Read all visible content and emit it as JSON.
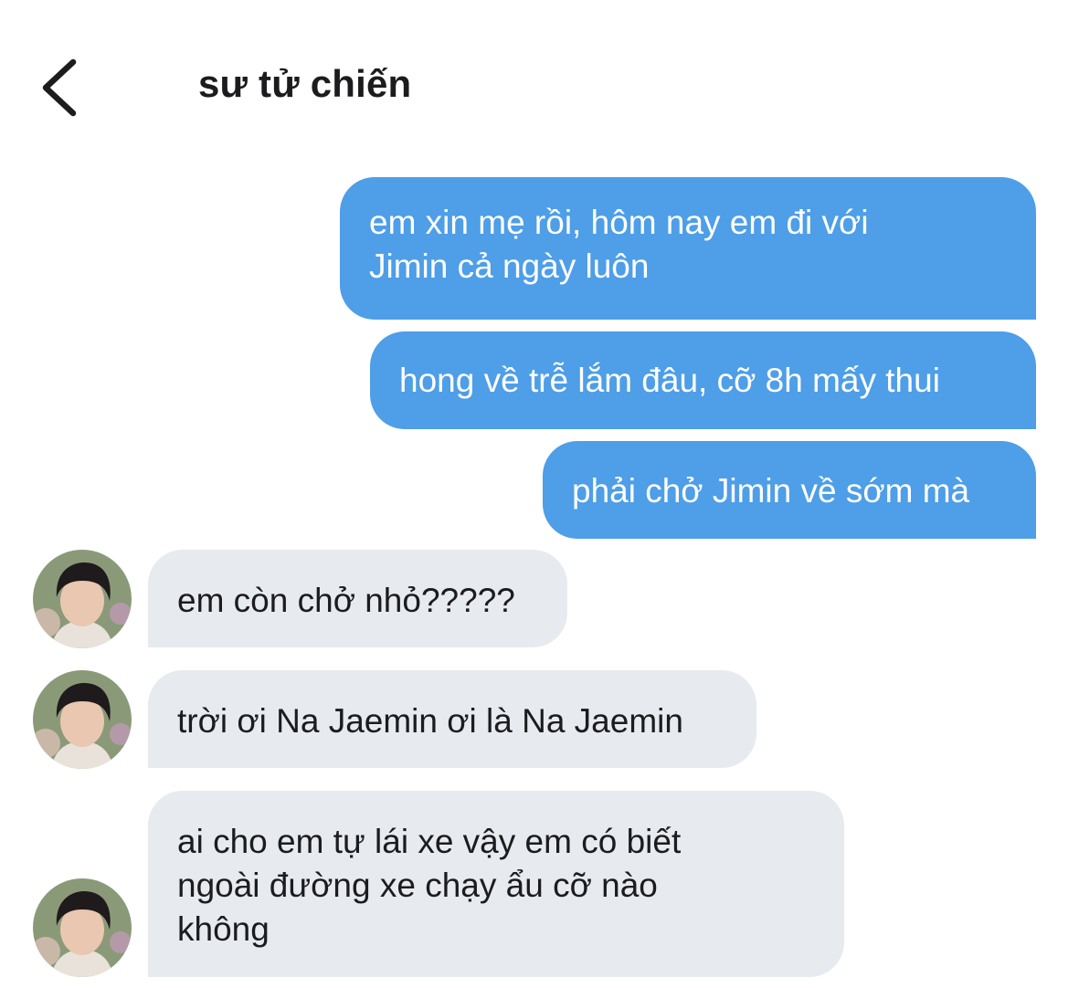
{
  "header": {
    "back_icon": "chevron-left-icon",
    "title": "sư tử chiến"
  },
  "messages": [
    {
      "sender": "me",
      "text": "em xin mẹ rồi, hôm nay em đi với\nJimin cả ngày luôn"
    },
    {
      "sender": "me",
      "text": "hong về trễ lắm đâu, cỡ 8h mấy thui"
    },
    {
      "sender": "me",
      "text": "phải chở Jimin về sớm mà"
    },
    {
      "sender": "contact",
      "text": "em còn chở nhỏ?????"
    },
    {
      "sender": "contact",
      "text": "trời ơi Na Jaemin ơi là Na Jaemin"
    },
    {
      "sender": "contact",
      "text": "ai cho em tự lái xe vậy em có biết\nngoài đường xe chạy ẩu cỡ nào\nkhông"
    }
  ],
  "colors": {
    "sent_bubble": "#4e9ee8",
    "received_bubble": "#e7eaee",
    "sent_text": "#ffffff",
    "received_text": "#1c1c1e"
  }
}
